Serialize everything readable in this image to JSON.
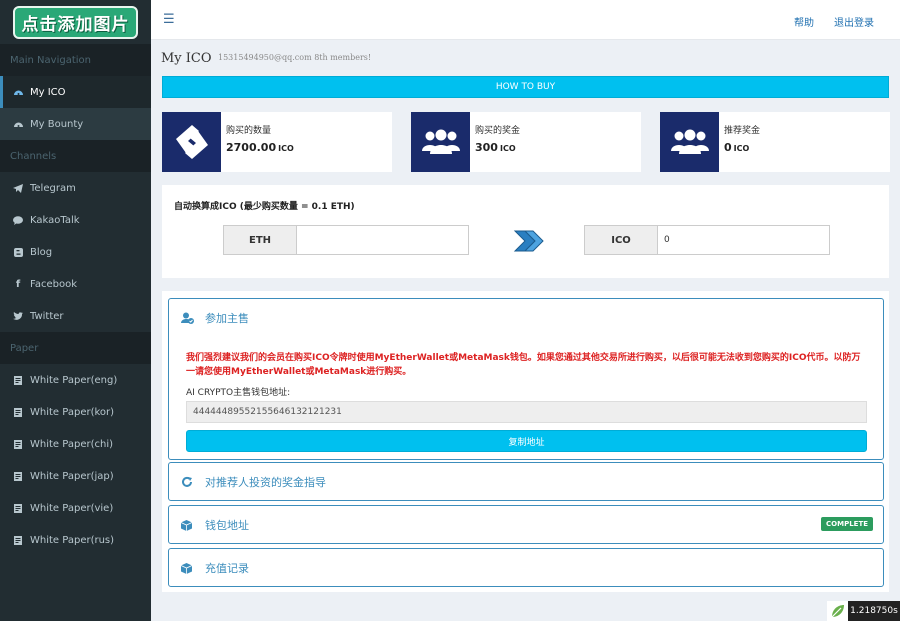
{
  "sidebar": {
    "logo": "点击添加图片",
    "sections": {
      "main": "Main Navigation",
      "channels": "Channels",
      "paper": "Paper"
    },
    "main_items": [
      {
        "label": "My ICO",
        "icon": "dashboard-icon"
      },
      {
        "label": "My Bounty",
        "icon": "dashboard-icon"
      }
    ],
    "channel_items": [
      {
        "label": "Telegram",
        "icon": "telegram-icon"
      },
      {
        "label": "KakaoTalk",
        "icon": "chat-icon"
      },
      {
        "label": "Blog",
        "icon": "blog-icon"
      },
      {
        "label": "Facebook",
        "icon": "facebook-icon"
      },
      {
        "label": "Twitter",
        "icon": "twitter-icon"
      }
    ],
    "paper_items": [
      {
        "label": "White Paper(eng)"
      },
      {
        "label": "White Paper(kor)"
      },
      {
        "label": "White Paper(chi)"
      },
      {
        "label": "White Paper(jap)"
      },
      {
        "label": "White Paper(vie)"
      },
      {
        "label": "White Paper(rus)"
      }
    ]
  },
  "topbar": {
    "help": "帮助",
    "logout": "退出登录"
  },
  "page": {
    "title": "My ICO",
    "subtitle": "15315494950@qq.com 8th members!",
    "how_to_buy": "HOW TO BUY"
  },
  "info_boxes": [
    {
      "label": "购买的数量",
      "value": "2700.00",
      "unit": "ICO",
      "icon": "ico-logo-icon"
    },
    {
      "label": "购买的奖金",
      "value": "300",
      "unit": "ICO",
      "icon": "users-icon"
    },
    {
      "label": "推荐奖金",
      "value": "0",
      "unit": "ICO",
      "icon": "users-icon"
    }
  ],
  "converter": {
    "title": "自动换算成ICO (最少购买数量 = 0.1 ETH)",
    "eth_label": "ETH",
    "eth_value": "",
    "ico_label": "ICO",
    "ico_value": "0"
  },
  "panels": [
    {
      "title": "参加主售",
      "icon": "user-check-icon",
      "warning": "我们强烈建议我们的会员在购买ICO令牌时使用MyEtherWallet或MetaMask钱包。如果您通过其他交易所进行购买，以后很可能无法收到您购买的ICO代币。以防万一请您使用MyEtherWallet或MetaMask进行购买。",
      "address_label": "AI CRYPTO主售钱包地址:",
      "address": "444444895521556461321​21231",
      "copy_label": "复制地址"
    },
    {
      "title": "对推荐人投资的奖金指导",
      "icon": "refresh-icon"
    },
    {
      "title": "钱包地址",
      "icon": "cube-icon",
      "badge": "COMPLETE"
    },
    {
      "title": "充值记录",
      "icon": "cube-icon"
    }
  ],
  "timer": "1.218750s",
  "colors": {
    "accent": "#00c0ef",
    "sidebar": "#222d32",
    "panel_border": "#3c8dbc",
    "icon_box": "#1a2b6b",
    "warning": "#dd2222",
    "badge": "#2c9c5e"
  }
}
